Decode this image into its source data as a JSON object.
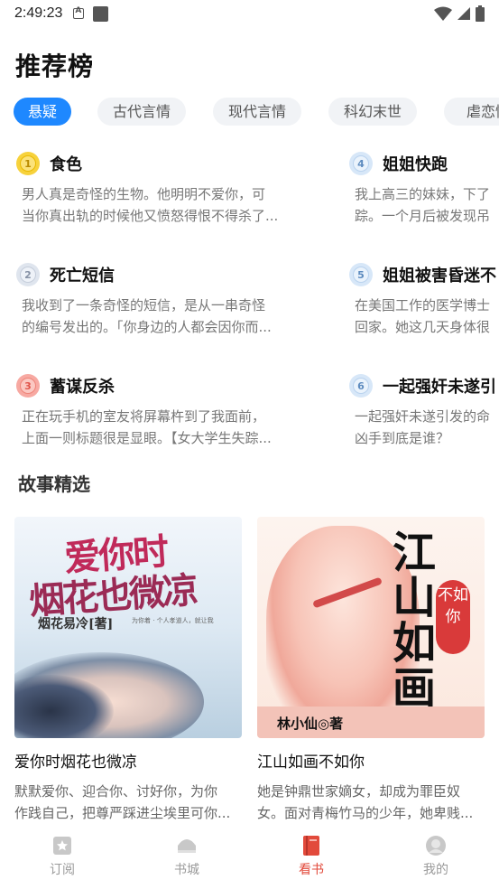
{
  "status": {
    "time": "2:49:23"
  },
  "page_title": "推荐榜",
  "tabs": [
    {
      "label": "悬疑"
    },
    {
      "label": "古代言情"
    },
    {
      "label": "现代言情"
    },
    {
      "label": "科幻末世"
    },
    {
      "label": "虐恋情"
    }
  ],
  "ranking": [
    {
      "rank": "1",
      "title": "食色",
      "desc": [
        "男人真是奇怪的生物。他明明不爱你，可",
        "当你真出轨的时候他又愤怒得恨不得杀了..."
      ]
    },
    {
      "rank": "2",
      "title": "死亡短信",
      "desc": [
        "我收到了一条奇怪的短信，是从一串奇怪",
        "的编号发出的。「你身边的人都会因你而..."
      ]
    },
    {
      "rank": "3",
      "title": "蓄谋反杀",
      "desc": [
        "正在玩手机的室友将屏幕杵到了我面前，",
        "上面一则标题很是显眼。【女大学生失踪..."
      ]
    },
    {
      "rank": "4",
      "title": "姐姐快跑",
      "desc": [
        "我上高三的妹妹，下了",
        "踪。一个月后被发现吊"
      ]
    },
    {
      "rank": "5",
      "title": "姐姐被害昏迷不",
      "desc": [
        "在美国工作的医学博士",
        "回家。她这几天身体很"
      ]
    },
    {
      "rank": "6",
      "title": "一起强奸未遂引",
      "desc": [
        "一起强奸未遂引发的命",
        "凶手到底是谁？"
      ]
    }
  ],
  "section_title": "故事精选",
  "stories": [
    {
      "title": "爱你时烟花也微凉",
      "desc": [
        "默默爱你、迎合你、讨好你，为你",
        "作践自己，把尊严踩进尘埃里可你..."
      ],
      "cover": {
        "line1": "爱你时",
        "line2": "烟花也微凉",
        "author": "烟花易冷[著]",
        "small": "为你着 · 个人孝道人，就让我"
      }
    },
    {
      "title": "江山如画不如你",
      "desc": [
        "她是钟鼎世家嫡女，却成为罪臣奴",
        "女。面对青梅竹马的少年，她卑贱..."
      ],
      "cover": {
        "text": "江山如画",
        "seal": "不如你",
        "author": "林小仙◎著"
      }
    }
  ],
  "bottom_nav": [
    {
      "label": "订阅",
      "icon": "star-badge-icon"
    },
    {
      "label": "书城",
      "icon": "bookstore-icon"
    },
    {
      "label": "看书",
      "icon": "book-icon"
    },
    {
      "label": "我的",
      "icon": "profile-icon"
    }
  ],
  "colors": {
    "accent": "#1e88ff",
    "nav_active": "#e24a3b"
  }
}
